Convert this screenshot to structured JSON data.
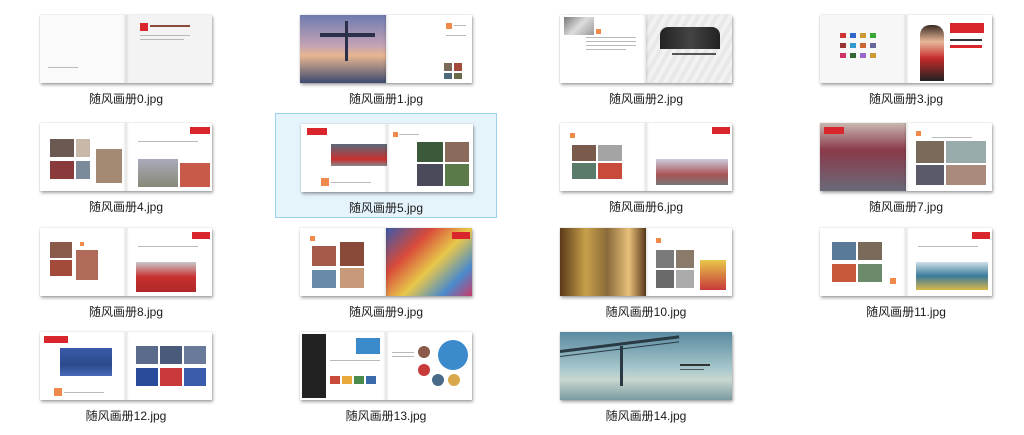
{
  "files": [
    {
      "name": "随风画册0.jpg"
    },
    {
      "name": "随风画册1.jpg"
    },
    {
      "name": "随风画册2.jpg"
    },
    {
      "name": "随风画册3.jpg"
    },
    {
      "name": "随风画册4.jpg"
    },
    {
      "name": "随风画册5.jpg",
      "selected": true
    },
    {
      "name": "随风画册6.jpg"
    },
    {
      "name": "随风画册7.jpg"
    },
    {
      "name": "随风画册8.jpg"
    },
    {
      "name": "随风画册9.jpg"
    },
    {
      "name": "随风画册10.jpg"
    },
    {
      "name": "随风画册11.jpg"
    },
    {
      "name": "随风画册12.jpg"
    },
    {
      "name": "随风画册13.jpg"
    },
    {
      "name": "随风画册14.jpg"
    }
  ],
  "colors": {
    "selection_bg": "#e5f3fb",
    "selection_border": "#99d1ef",
    "accent_red": "#d8262c",
    "accent_orange": "#f08a4b"
  }
}
